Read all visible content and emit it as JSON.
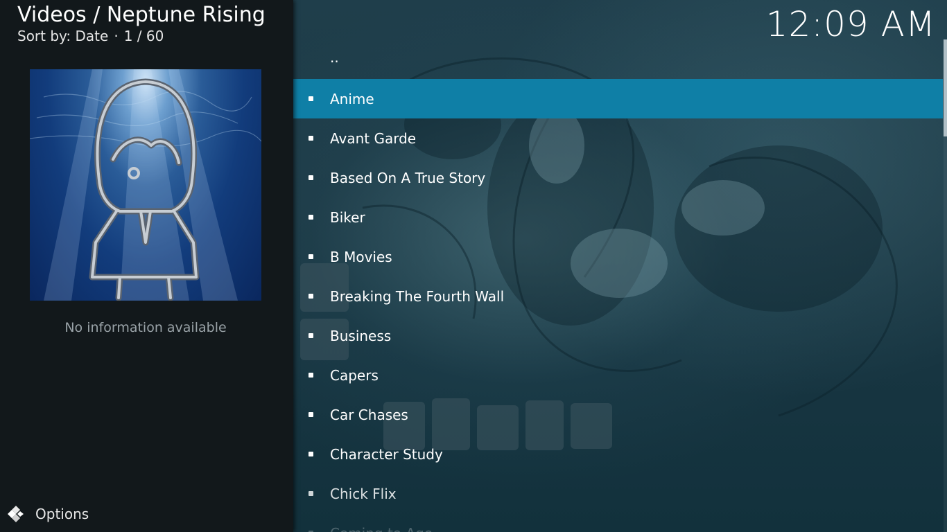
{
  "header": {
    "title": "Videos /  Neptune Rising",
    "sort_label": "Sort by: Date",
    "separator": "·",
    "position": "1 / 60"
  },
  "info_panel": {
    "no_info_text": "No information available"
  },
  "options": {
    "icon": "kodi-gear-icon",
    "label": "Options"
  },
  "clock": "12:09 AM",
  "list": {
    "parent_label": "..",
    "items": [
      {
        "label": "Anime",
        "selected": true
      },
      {
        "label": "Avant Garde"
      },
      {
        "label": "Based On A True Story"
      },
      {
        "label": "Biker"
      },
      {
        "label": "B Movies"
      },
      {
        "label": "Breaking The Fourth Wall"
      },
      {
        "label": "Business"
      },
      {
        "label": "Capers"
      },
      {
        "label": "Car Chases"
      },
      {
        "label": "Character Study"
      },
      {
        "label": "Chick Flix"
      },
      {
        "label": "Coming to Age"
      }
    ]
  },
  "colors": {
    "selected_row": "#0f7fa6",
    "panel_bg": "#12181b"
  }
}
